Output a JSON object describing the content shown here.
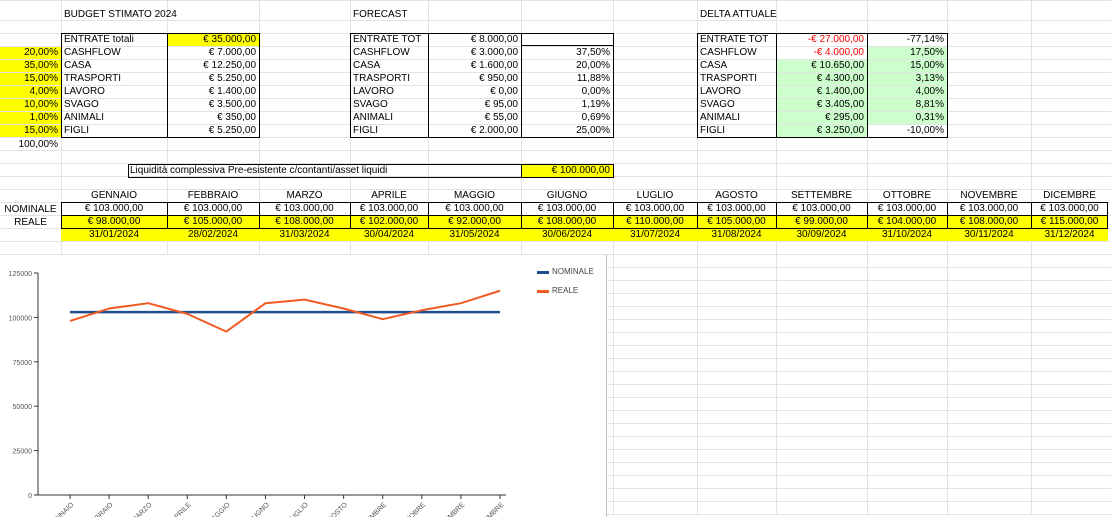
{
  "budget": {
    "title": "BUDGET STIMATO 2024",
    "entrate_label": "ENTRATE totali",
    "entrate_value": "€ 35.000,00",
    "rows": [
      {
        "pct": "20,00%",
        "label": "CASHFLOW",
        "value": "€ 7.000,00"
      },
      {
        "pct": "35,00%",
        "label": "CASA",
        "value": "€ 12.250,00"
      },
      {
        "pct": "15,00%",
        "label": "TRASPORTI",
        "value": "€ 5.250,00"
      },
      {
        "pct": "4,00%",
        "label": "LAVORO",
        "value": "€ 1.400,00"
      },
      {
        "pct": "10,00%",
        "label": "SVAGO",
        "value": "€ 3.500,00"
      },
      {
        "pct": "1,00%",
        "label": "ANIMALI",
        "value": "€ 350,00"
      },
      {
        "pct": "15,00%",
        "label": "FIGLI",
        "value": "€ 5.250,00"
      }
    ],
    "total_pct": "100,00%"
  },
  "forecast": {
    "title": "FORECAST",
    "entrate_label": "ENTRATE TOT",
    "entrate_value": "€ 8.000,00",
    "rows": [
      {
        "label": "CASHFLOW",
        "value": "€ 3.000,00",
        "pct": "37,50%"
      },
      {
        "label": "CASA",
        "value": "€ 1.600,00",
        "pct": "20,00%"
      },
      {
        "label": "TRASPORTI",
        "value": "€ 950,00",
        "pct": "11,88%"
      },
      {
        "label": "LAVORO",
        "value": "€ 0,00",
        "pct": "0,00%"
      },
      {
        "label": "SVAGO",
        "value": "€ 95,00",
        "pct": "1,19%"
      },
      {
        "label": "ANIMALI",
        "value": "€ 55,00",
        "pct": "0,69%"
      },
      {
        "label": "FIGLI",
        "value": "€ 2.000,00",
        "pct": "25,00%"
      }
    ]
  },
  "delta": {
    "title": "DELTA ATTUALE",
    "entrate_label": "ENTRATE TOT",
    "entrate_value": "-€ 27.000,00",
    "entrate_pct": "-77,14%",
    "rows": [
      {
        "label": "CASHFLOW",
        "value": "-€ 4.000,00",
        "pct": "17,50%",
        "neg": true,
        "pct_green": true
      },
      {
        "label": "CASA",
        "value": "€ 10.650,00",
        "pct": "15,00%",
        "neg": false,
        "pct_green": true
      },
      {
        "label": "TRASPORTI",
        "value": "€ 4.300,00",
        "pct": "3,13%",
        "neg": false,
        "pct_green": true
      },
      {
        "label": "LAVORO",
        "value": "€ 1.400,00",
        "pct": "4,00%",
        "neg": false,
        "pct_green": true
      },
      {
        "label": "SVAGO",
        "value": "€ 3.405,00",
        "pct": "8,81%",
        "neg": false,
        "pct_green": true
      },
      {
        "label": "ANIMALI",
        "value": "€ 295,00",
        "pct": "0,31%",
        "neg": false,
        "pct_green": true
      },
      {
        "label": "FIGLI",
        "value": "€ 3.250,00",
        "pct": "-10,00%",
        "neg": false,
        "pct_green": false
      }
    ]
  },
  "liquidita": {
    "label": "Liquidità complessiva Pre-esistente c/contanti/asset liquidi",
    "value": "€ 100.000,00"
  },
  "monthly": {
    "row_labels": {
      "nominale": "NOMINALE",
      "reale": "REALE"
    },
    "months": [
      "GENNAIO",
      "FEBBRAIO",
      "MARZO",
      "APRILE",
      "MAGGIO",
      "GIUGNO",
      "LUGLIO",
      "AGOSTO",
      "SETTEMBRE",
      "OTTOBRE",
      "NOVEMBRE",
      "DICEMBRE"
    ],
    "nominale": [
      "€ 103.000,00",
      "€ 103.000,00",
      "€ 103.000,00",
      "€ 103.000,00",
      "€ 103.000,00",
      "€ 103.000,00",
      "€ 103.000,00",
      "€ 103.000,00",
      "€ 103.000,00",
      "€ 103.000,00",
      "€ 103.000,00",
      "€ 103.000,00"
    ],
    "reale": [
      "€ 98.000,00",
      "€ 105.000,00",
      "€ 108.000,00",
      "€ 102.000,00",
      "€ 92.000,00",
      "€ 108.000,00",
      "€ 110.000,00",
      "€ 105.000,00",
      "€ 99.000,00",
      "€ 104.000,00",
      "€ 108.000,00",
      "€ 115.000,00"
    ],
    "dates": [
      "31/01/2024",
      "28/02/2024",
      "31/03/2024",
      "30/04/2024",
      "31/05/2024",
      "30/06/2024",
      "31/07/2024",
      "31/08/2024",
      "30/09/2024",
      "31/10/2024",
      "30/11/2024",
      "31/12/2024"
    ]
  },
  "colors": {
    "highlight_yellow": "#ffff00",
    "positive_green": "#ccffcc",
    "negative_red": "#ff0000",
    "series_nominale": "#1f4e8c",
    "series_reale": "#f15a24"
  },
  "chart_data": {
    "type": "line",
    "x": [
      "GENNAIO",
      "FEBBRAIO",
      "MARZO",
      "APRILE",
      "MAGGIO",
      "GIUGNO",
      "LUGLIO",
      "AGOSTO",
      "SETTEMBRE",
      "OTTOBRE",
      "NOVEMBRE",
      "DICEMBRE"
    ],
    "series": [
      {
        "name": "NOMINALE",
        "values": [
          103000,
          103000,
          103000,
          103000,
          103000,
          103000,
          103000,
          103000,
          103000,
          103000,
          103000,
          103000
        ]
      },
      {
        "name": "REALE",
        "values": [
          98000,
          105000,
          108000,
          102000,
          92000,
          108000,
          110000,
          105000,
          99000,
          104000,
          108000,
          115000
        ]
      }
    ],
    "yticks": [
      "0",
      "25000",
      "50000",
      "75000",
      "100000",
      "125000"
    ],
    "ylim": [
      0,
      125000
    ],
    "legend_position": "right",
    "grid": false
  }
}
